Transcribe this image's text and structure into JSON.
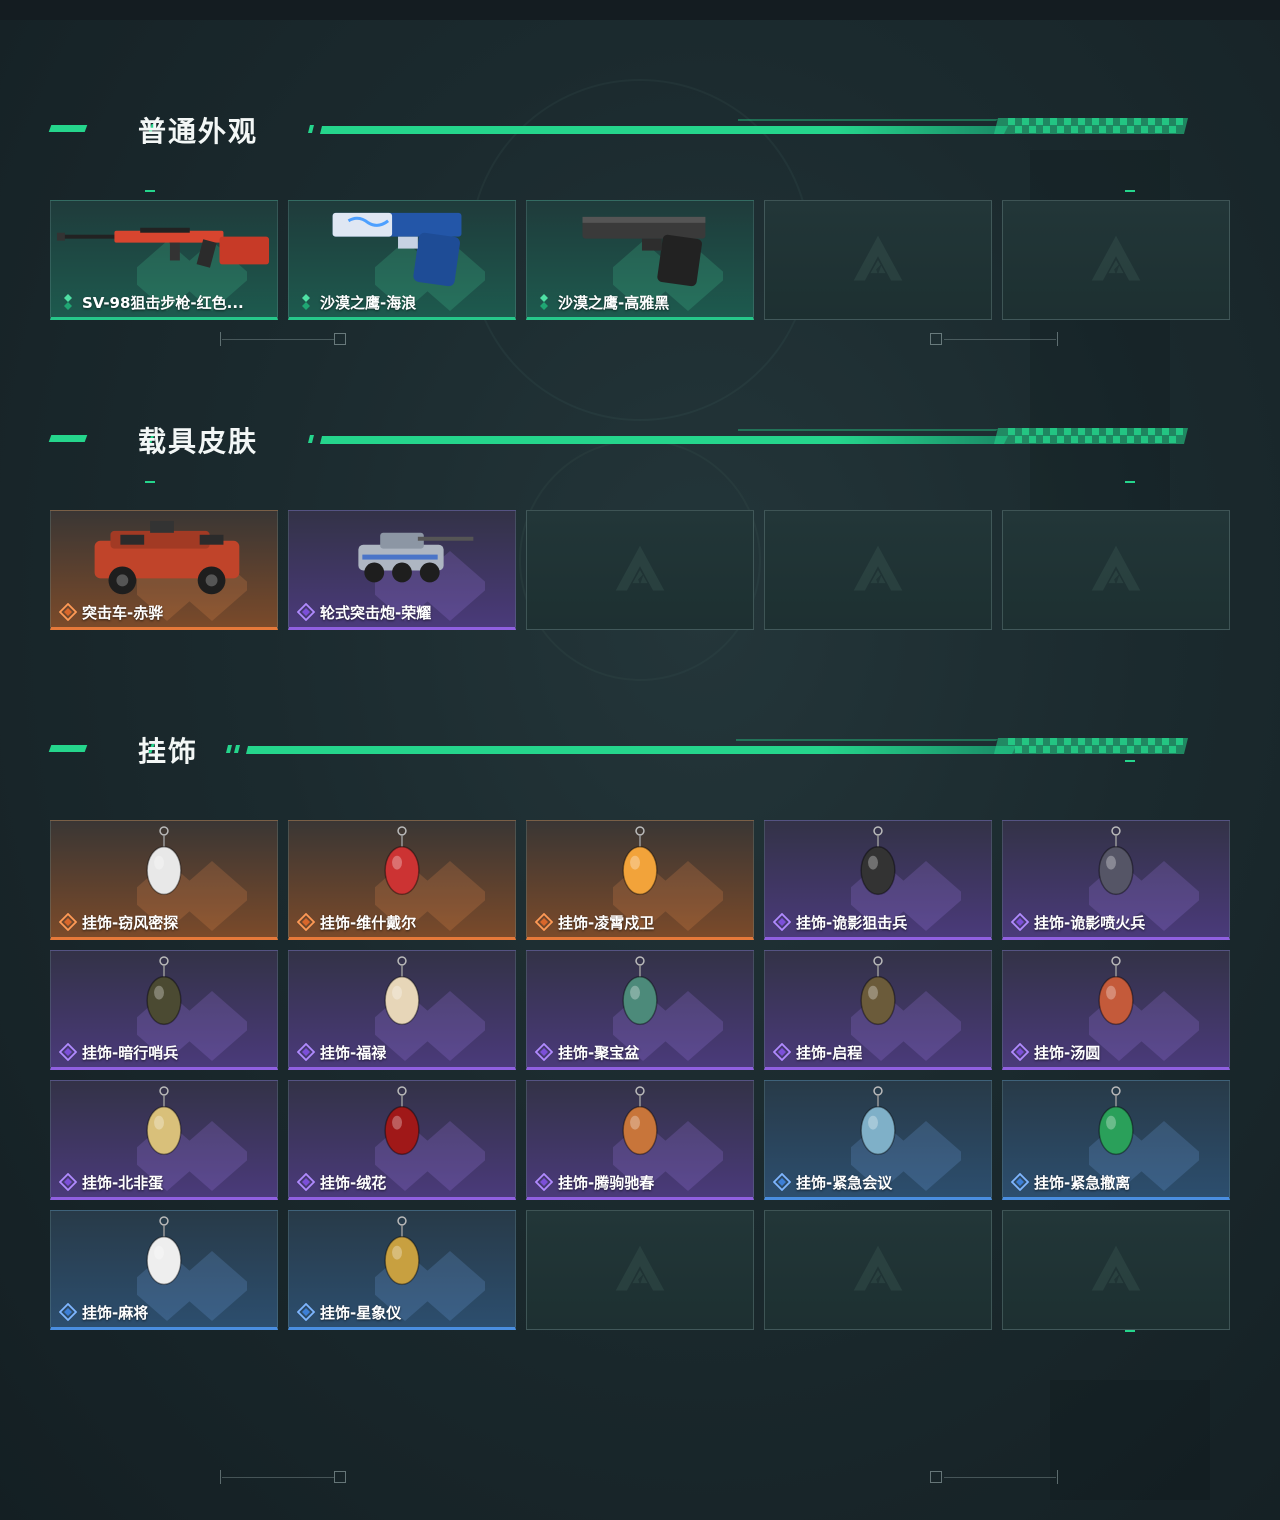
{
  "sections": [
    {
      "title": "普通外观",
      "items": [
        {
          "label": "SV-98狙击步枪-红色...",
          "rarity": "green",
          "art": "sniper-rifle"
        },
        {
          "label": "沙漠之鹰-海浪",
          "rarity": "green",
          "art": "pistol-blue"
        },
        {
          "label": "沙漠之鹰-高雅黑",
          "rarity": "green",
          "art": "pistol-black"
        },
        {
          "label": "",
          "rarity": "empty"
        },
        {
          "label": "",
          "rarity": "empty"
        }
      ]
    },
    {
      "title": "载具皮肤",
      "items": [
        {
          "label": "突击车-赤骅",
          "rarity": "orange",
          "art": "assault-car"
        },
        {
          "label": "轮式突击炮-荣耀",
          "rarity": "purple",
          "art": "wheeled-gun"
        },
        {
          "label": "",
          "rarity": "empty"
        },
        {
          "label": "",
          "rarity": "empty"
        },
        {
          "label": "",
          "rarity": "empty"
        }
      ]
    },
    {
      "title": "挂饰",
      "items": [
        {
          "label": "挂饰-窃风密探",
          "rarity": "orange",
          "art": "charm"
        },
        {
          "label": "挂饰-维什戴尔",
          "rarity": "orange",
          "art": "charm"
        },
        {
          "label": "挂饰-凌霄戍卫",
          "rarity": "orange",
          "art": "charm"
        },
        {
          "label": "挂饰-诡影狙击兵",
          "rarity": "purple",
          "art": "charm"
        },
        {
          "label": "挂饰-诡影喷火兵",
          "rarity": "purple",
          "art": "charm"
        },
        {
          "label": "挂饰-暗行哨兵",
          "rarity": "purple",
          "art": "charm"
        },
        {
          "label": "挂饰-福禄",
          "rarity": "purple",
          "art": "charm"
        },
        {
          "label": "挂饰-聚宝盆",
          "rarity": "purple",
          "art": "charm"
        },
        {
          "label": "挂饰-启程",
          "rarity": "purple",
          "art": "charm"
        },
        {
          "label": "挂饰-汤圆",
          "rarity": "purple",
          "art": "charm"
        },
        {
          "label": "挂饰-北非蛋",
          "rarity": "purple",
          "art": "charm"
        },
        {
          "label": "挂饰-绒花",
          "rarity": "purple",
          "art": "charm"
        },
        {
          "label": "挂饰-腾驹驰春",
          "rarity": "purple",
          "art": "charm"
        },
        {
          "label": "挂饰-紧急会议",
          "rarity": "blue",
          "art": "charm"
        },
        {
          "label": "挂饰-紧急撤离",
          "rarity": "blue",
          "art": "charm"
        },
        {
          "label": "挂饰-麻将",
          "rarity": "blue",
          "art": "charm"
        },
        {
          "label": "挂饰-星象仪",
          "rarity": "blue",
          "art": "charm"
        },
        {
          "label": "",
          "rarity": "empty"
        },
        {
          "label": "",
          "rarity": "empty"
        },
        {
          "label": "",
          "rarity": "empty"
        }
      ]
    }
  ],
  "colors": {
    "accent": "#25d58c",
    "green": "#26c78a",
    "orange": "#e5793a",
    "purple": "#9060e0",
    "blue": "#4a8ee0"
  },
  "rarity_icons": {
    "green": "green-rarity-icon",
    "orange": "orange-rarity-icon",
    "purple": "purple-rarity-icon",
    "blue": "blue-rarity-icon",
    "empty": "game-logo-icon"
  }
}
